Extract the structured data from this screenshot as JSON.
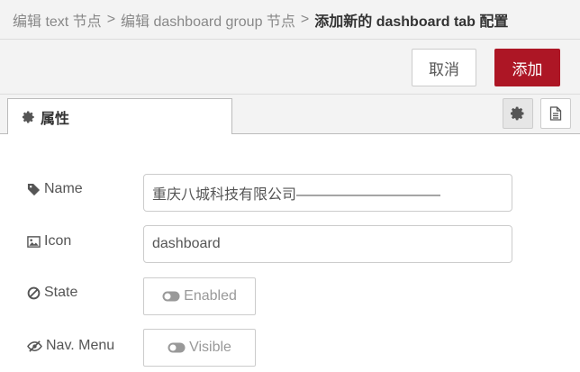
{
  "breadcrumb": {
    "items": [
      "编辑 text 节点",
      "编辑 dashboard group 节点"
    ],
    "separator": ">",
    "current": "添加新的 dashboard tab 配置"
  },
  "toolbar": {
    "cancel_label": "取消",
    "add_label": "添加"
  },
  "tabs": {
    "properties_label": "属性",
    "properties_icon": "gear-icon",
    "settings_icon": "gear-icon",
    "info_icon": "document-icon"
  },
  "form": {
    "name": {
      "label": "Name",
      "icon": "tag-icon",
      "value": "重庆八城科技有限公司——————————"
    },
    "icon": {
      "label": "Icon",
      "icon": "image-icon",
      "value": "dashboard"
    },
    "state": {
      "label": "State",
      "icon": "ban-icon",
      "toggle_label": "Enabled"
    },
    "nav_menu": {
      "label": "Nav. Menu",
      "icon": "eye-slash-icon",
      "toggle_label": "Visible"
    }
  },
  "colors": {
    "primary": "#ad1625",
    "panel_bg": "#f3f3f3"
  }
}
